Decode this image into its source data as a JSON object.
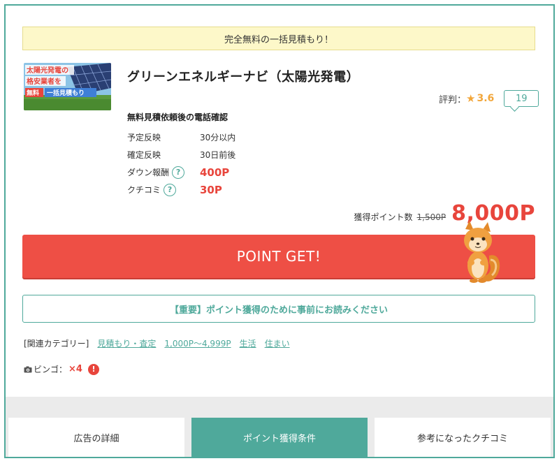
{
  "notice": {
    "text": "完全無料の一括見積もり！"
  },
  "thumbnail": {
    "line1": "太陽光発電の",
    "line2": "格安業者を",
    "badge_free": "無料",
    "badge_quote": "一括見積もり"
  },
  "offer": {
    "title": "グリーンエネルギーナビ（太陽光発電）",
    "condition": "無料見積依頼後の電話確認",
    "rating_label": "評判：",
    "rating_star": "★",
    "rating_score": "3.6",
    "review_count": "19"
  },
  "details": [
    {
      "label": "予定反映",
      "value": "30分以内"
    },
    {
      "label": "確定反映",
      "value": "30日前後"
    },
    {
      "label": "ダウン報酬",
      "value": "400P"
    },
    {
      "label": "クチコミ",
      "value": "30P"
    }
  ],
  "help_icon_text": "?",
  "points": {
    "label": "獲得ポイント数",
    "old": "1,500P",
    "new": "8,000P"
  },
  "buttons": {
    "point_get": "POINT GET!",
    "important": "【重要】ポイント獲得のために事前にお読みください"
  },
  "categories": {
    "label": "[関連カテゴリー]",
    "items": [
      "見積もり・査定",
      "1,000P〜4,999P",
      "生活",
      "住まい"
    ]
  },
  "bingo": {
    "label": "ビンゴ：",
    "multiplier": "×4",
    "alert": "!"
  },
  "tabs": [
    {
      "label": "広告の詳細",
      "active": false
    },
    {
      "label": "ポイント獲得条件",
      "active": true
    },
    {
      "label": "参考になったクチコミ",
      "active": false
    }
  ],
  "colors": {
    "accent_teal": "#4fa99b",
    "point_red": "#ee4f45",
    "star_orange": "#f2a63a",
    "notice_yellow": "#fdf8c9"
  }
}
